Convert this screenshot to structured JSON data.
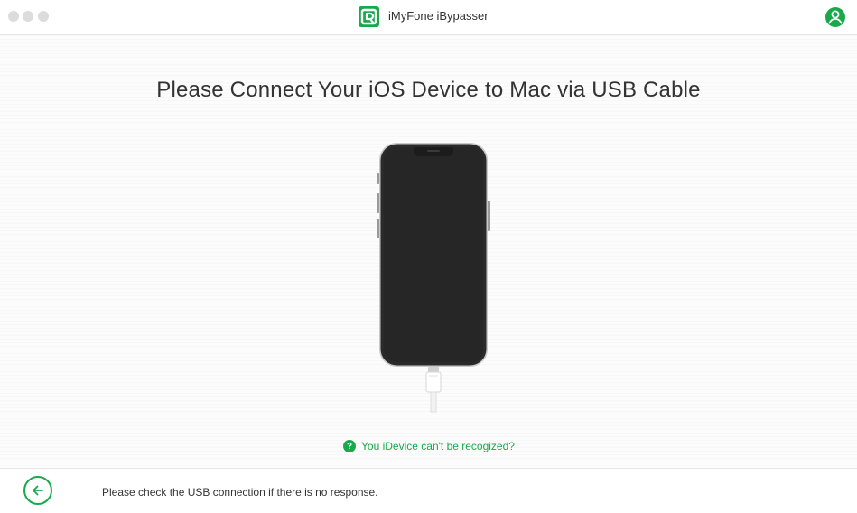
{
  "window": {
    "title": "iMyFone iBypasser",
    "logo_icon": "imyfone-logo-icon",
    "account_icon": "user-account-icon",
    "accent_color": "#19a94b"
  },
  "main": {
    "heading": "Please Connect Your iOS Device to Mac via USB Cable",
    "illustration": "iphone-with-usb-cable",
    "help_link": "You iDevice can't be recogized?",
    "help_icon": "question-circle-icon"
  },
  "footer": {
    "back_icon": "arrow-left-icon",
    "note": "Please check the USB connection if there is no response."
  }
}
